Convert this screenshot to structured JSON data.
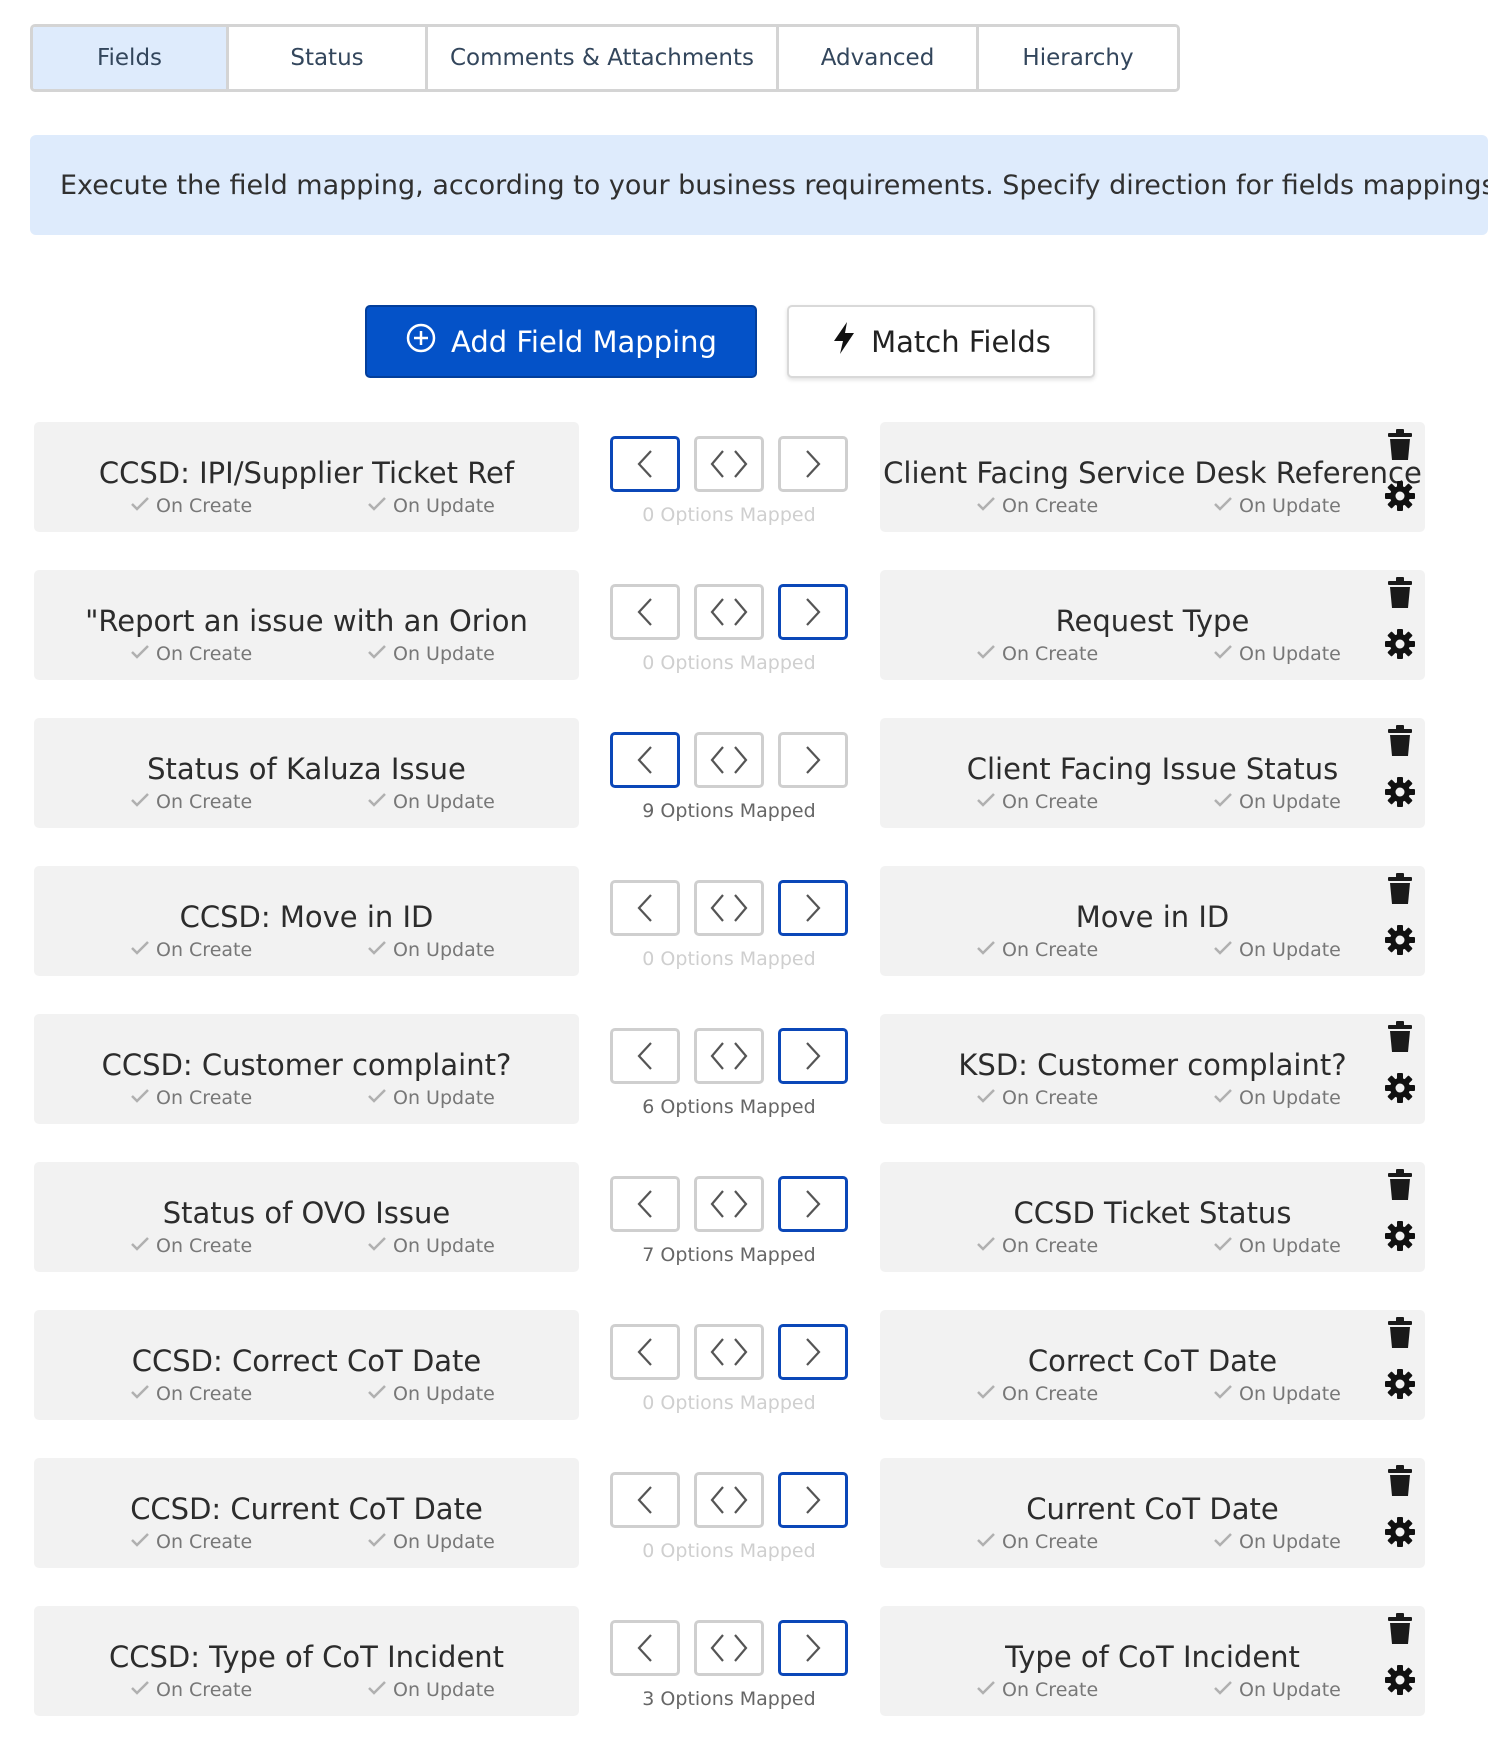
{
  "tabs": [
    {
      "label": "Fields",
      "active": true
    },
    {
      "label": "Status",
      "active": false
    },
    {
      "label": "Comments & Attachments",
      "active": false
    },
    {
      "label": "Advanced",
      "active": false
    },
    {
      "label": "Hierarchy",
      "active": false
    }
  ],
  "banner": {
    "text": "Execute the field mapping, according to your business requirements. Specify direction for fields mappings if ot"
  },
  "actions": {
    "add_label": "Add Field Mapping",
    "match_label": "Match Fields"
  },
  "flags": {
    "create": "On Create",
    "update": "On Update"
  },
  "colors": {
    "accent": "#0452c8",
    "active_border": "#0b47b8",
    "tab_active_bg": "#deebfc",
    "row_bg": "#f2f2f2"
  },
  "mappings": [
    {
      "left": "CCSD: IPI/Supplier Ticket Ref",
      "right": "Client Facing Service Desk Reference",
      "direction": "left",
      "options": "0 Options Mapped",
      "options_count": 0
    },
    {
      "left": "\"Report an issue with an Orion",
      "right": "Request Type",
      "direction": "right",
      "options": "0 Options Mapped",
      "options_count": 0
    },
    {
      "left": "Status of Kaluza Issue",
      "right": "Client Facing Issue Status",
      "direction": "left",
      "options": "9 Options Mapped",
      "options_count": 9
    },
    {
      "left": "CCSD: Move in ID",
      "right": "Move in ID",
      "direction": "right",
      "options": "0 Options Mapped",
      "options_count": 0
    },
    {
      "left": "CCSD: Customer complaint?",
      "right": "KSD: Customer complaint?",
      "direction": "right",
      "options": "6 Options Mapped",
      "options_count": 6
    },
    {
      "left": "Status of OVO Issue",
      "right": "CCSD Ticket Status",
      "direction": "right",
      "options": "7 Options Mapped",
      "options_count": 7
    },
    {
      "left": "CCSD: Correct CoT Date",
      "right": "Correct CoT Date",
      "direction": "right",
      "options": "0 Options Mapped",
      "options_count": 0
    },
    {
      "left": "CCSD: Current CoT Date",
      "right": "Current CoT Date",
      "direction": "right",
      "options": "0 Options Mapped",
      "options_count": 0
    },
    {
      "left": "CCSD: Type of CoT Incident",
      "right": "Type of CoT Incident",
      "direction": "right",
      "options": "3 Options Mapped",
      "options_count": 3
    }
  ]
}
